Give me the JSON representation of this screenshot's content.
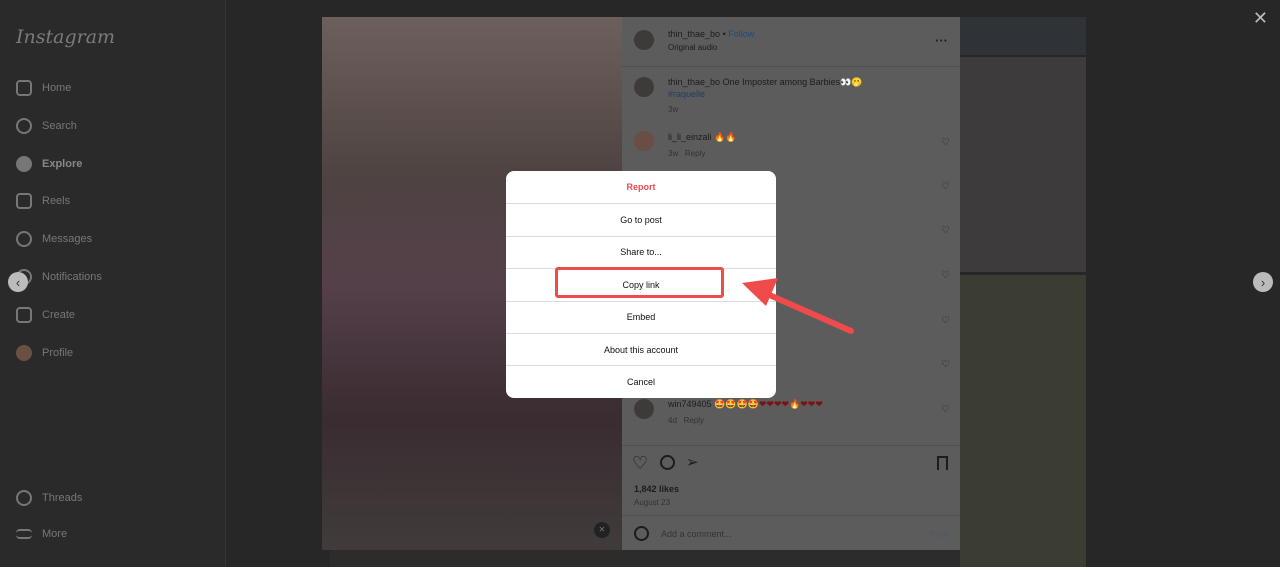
{
  "app": {
    "logo": "Instagram"
  },
  "sidebar": {
    "items": [
      {
        "label": "Home"
      },
      {
        "label": "Search"
      },
      {
        "label": "Explore"
      },
      {
        "label": "Reels"
      },
      {
        "label": "Messages"
      },
      {
        "label": "Notifications"
      },
      {
        "label": "Create"
      },
      {
        "label": "Profile"
      }
    ],
    "threads": "Threads",
    "more": "More"
  },
  "post": {
    "username": "thin_thae_bo",
    "follow": "Follow",
    "audio": "Original audio",
    "caption": {
      "user": "thin_thae_bo",
      "text": "One Imposter among Barbies👀🫢",
      "tag": "#raquelle",
      "time": "3w"
    },
    "comments": [
      {
        "user": "li_li_einzali",
        "text": "🔥🔥",
        "time": "3w",
        "reply": "Reply"
      },
      {
        "user": "win749405",
        "text": "🤩🤩🤩🤩❤❤❤❤🔥❤❤❤",
        "time": "4d",
        "reply": "Reply"
      }
    ],
    "likes": "1,842 likes",
    "date": "August 23",
    "comment_placeholder": "Add a comment...",
    "post_button": "Post"
  },
  "menu": {
    "items": [
      "Report",
      "Go to post",
      "Share to...",
      "Copy link",
      "Embed",
      "About this account",
      "Cancel"
    ]
  },
  "annotation": {
    "color": "#ef4b4b"
  }
}
